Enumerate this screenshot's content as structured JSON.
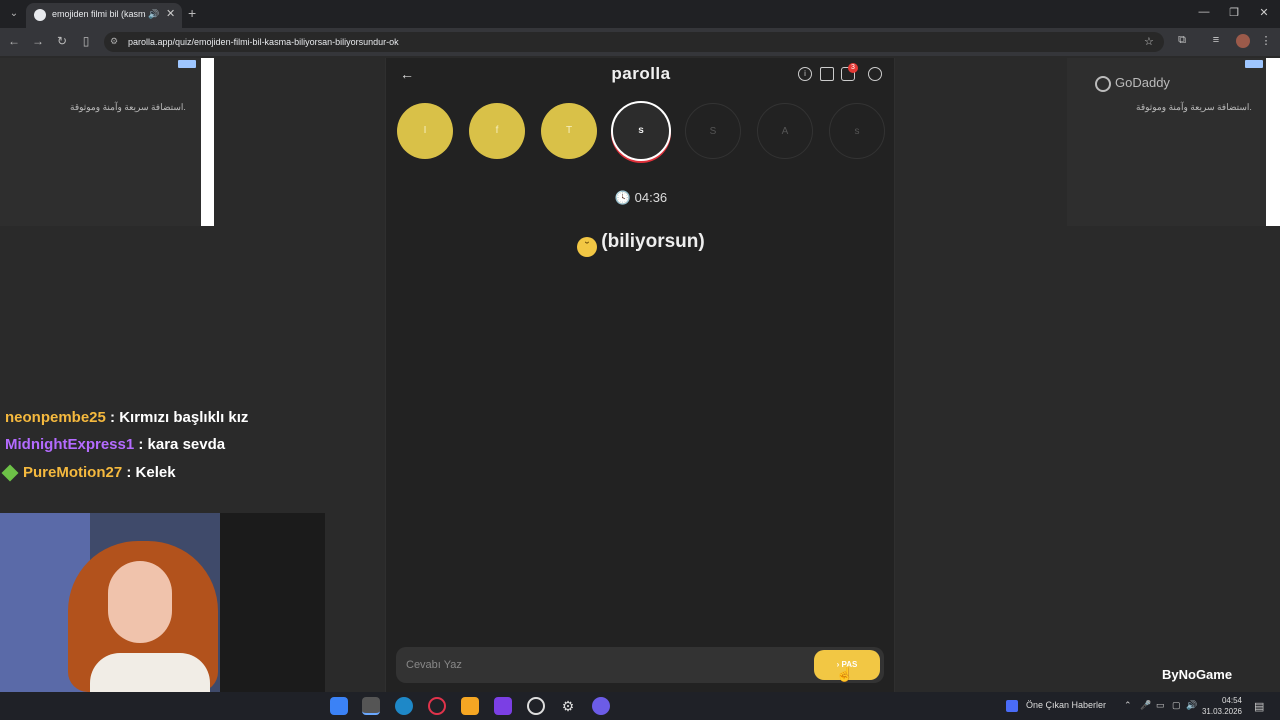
{
  "browser": {
    "tab_title": "emojiden filmi bil (kasma b",
    "url": "parolla.app/quiz/emojiden-filmi-bil-kasma-biliyorsan-biliyorsundur-ok"
  },
  "ads": {
    "left_text": "استضافة سريعة وآمنة وموثوقة.",
    "right_brand": "GoDaddy",
    "right_text": "استضافة سريعة وآمنة وموثوقة."
  },
  "game": {
    "logo": "parolla",
    "notification_count": "3",
    "letters": [
      {
        "char": "I",
        "state": "done"
      },
      {
        "char": "f",
        "state": "done"
      },
      {
        "char": "T",
        "state": "done"
      },
      {
        "char": "s",
        "state": "active"
      },
      {
        "char": "S",
        "state": "pending"
      },
      {
        "char": "A",
        "state": "pending"
      },
      {
        "char": "s",
        "state": "pending"
      }
    ],
    "timer": "04:36",
    "clue_text": "(biliyorsun)",
    "answer_placeholder": "Cevabı Yaz",
    "pass_label": "PAS"
  },
  "chat": [
    {
      "user": "neonpembe25",
      "message": " : Kırmızı başlıklı kız"
    },
    {
      "user": "MidnightExpress1",
      "message": " : kara sevda"
    },
    {
      "user": "PureMotion27",
      "message": " : Kelek"
    }
  ],
  "watermark": "ByNoGame",
  "taskbar": {
    "news": "Öne Çıkan Haberler",
    "time": "04:54",
    "date": "31.03.2026"
  },
  "colors": {
    "done_letter": "#d9c148",
    "pass_button": "#f2c744",
    "active_ring": "#e0313b"
  }
}
